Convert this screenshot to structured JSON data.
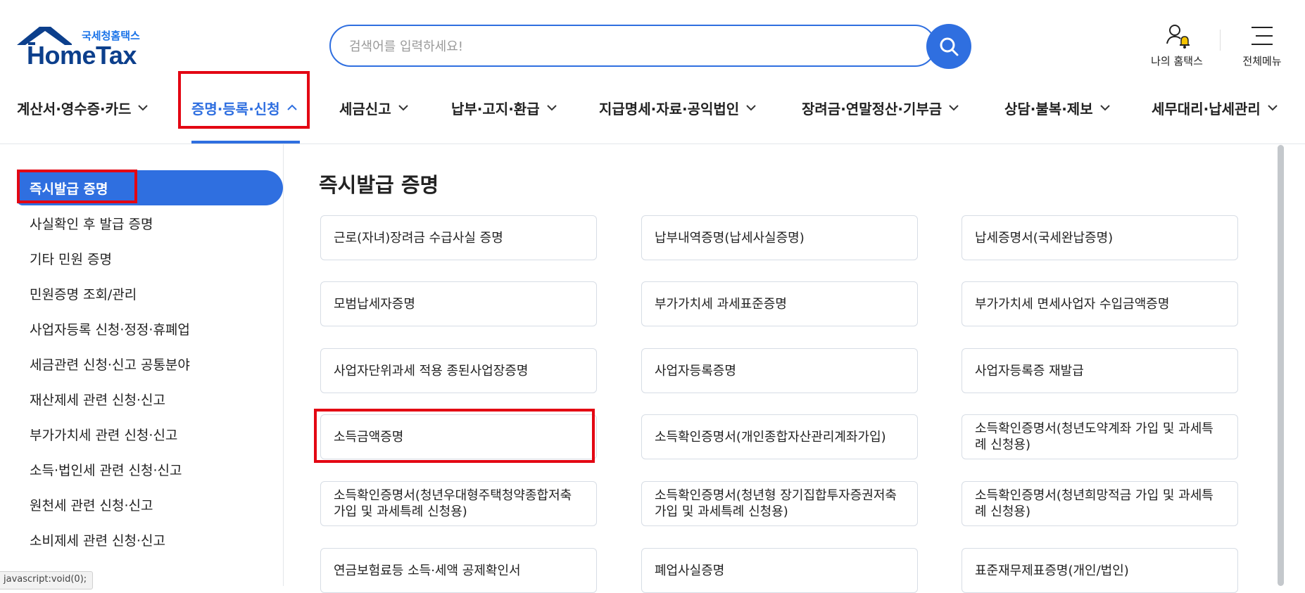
{
  "brand": {
    "sub": "국세청홈택스",
    "main": "HomeTax",
    "color": "#0c3f8c",
    "accent": "#2f6fe0"
  },
  "search": {
    "placeholder": "검색어를 입력하세요!",
    "icon": "search-icon"
  },
  "header_links": {
    "my_hometax": "나의 홈택스",
    "all_menu": "전체메뉴"
  },
  "gnb": [
    {
      "label": "계산서·영수증·카드",
      "active": false
    },
    {
      "label": "증명·등록·신청",
      "active": true
    },
    {
      "label": "세금신고",
      "active": false
    },
    {
      "label": "납부·고지·환급",
      "active": false
    },
    {
      "label": "지급명세·자료·공익법인",
      "active": false
    },
    {
      "label": "장려금·연말정산·기부금",
      "active": false
    },
    {
      "label": "상담·불복·제보",
      "active": false
    },
    {
      "label": "세무대리·납세관리",
      "active": false
    }
  ],
  "sidebar": [
    "즉시발급 증명",
    "사실확인 후 발급 증명",
    "기타 민원 증명",
    "민원증명 조회/관리",
    "사업자등록 신청·정정·휴폐업",
    "세금관련 신청·신고 공통분야",
    "재산제세 관련 신청·신고",
    "부가가치세 관련 신청·신고",
    "소득·법인세 관련 신청·신고",
    "원천세 관련 신청·신고",
    "소비제세 관련 신청·신고"
  ],
  "status_tip": "javascript:void(0);",
  "main": {
    "title": "즉시발급 증명",
    "cards": [
      "근로(자녀)장려금 수급사실 증명",
      "납부내역증명(납세사실증명)",
      "납세증명서(국세완납증명)",
      "모범납세자증명",
      "부가가치세 과세표준증명",
      "부가가치세 면세사업자 수입금액증명",
      "사업자단위과세 적용 종된사업장증명",
      "사업자등록증명",
      "사업자등록증 재발급",
      "소득금액증명",
      "소득확인증명서(개인종합자산관리계좌가입)",
      "소득확인증명서(청년도약계좌 가입 및 과세특례 신청용)",
      "소득확인증명서(청년우대형주택청약종합저축 가입 및 과세특례 신청용)",
      "소득확인증명서(청년형 장기집합투자증권저축 가입 및 과세특례 신청용)",
      "소득확인증명서(청년희망적금 가입 및 과세특례 신청용)",
      "연금보험료등 소득·세액 공제확인서",
      "폐업사실증명",
      "표준재무제표증명(개인/법인)"
    ]
  },
  "highlight_color": "#e30613"
}
